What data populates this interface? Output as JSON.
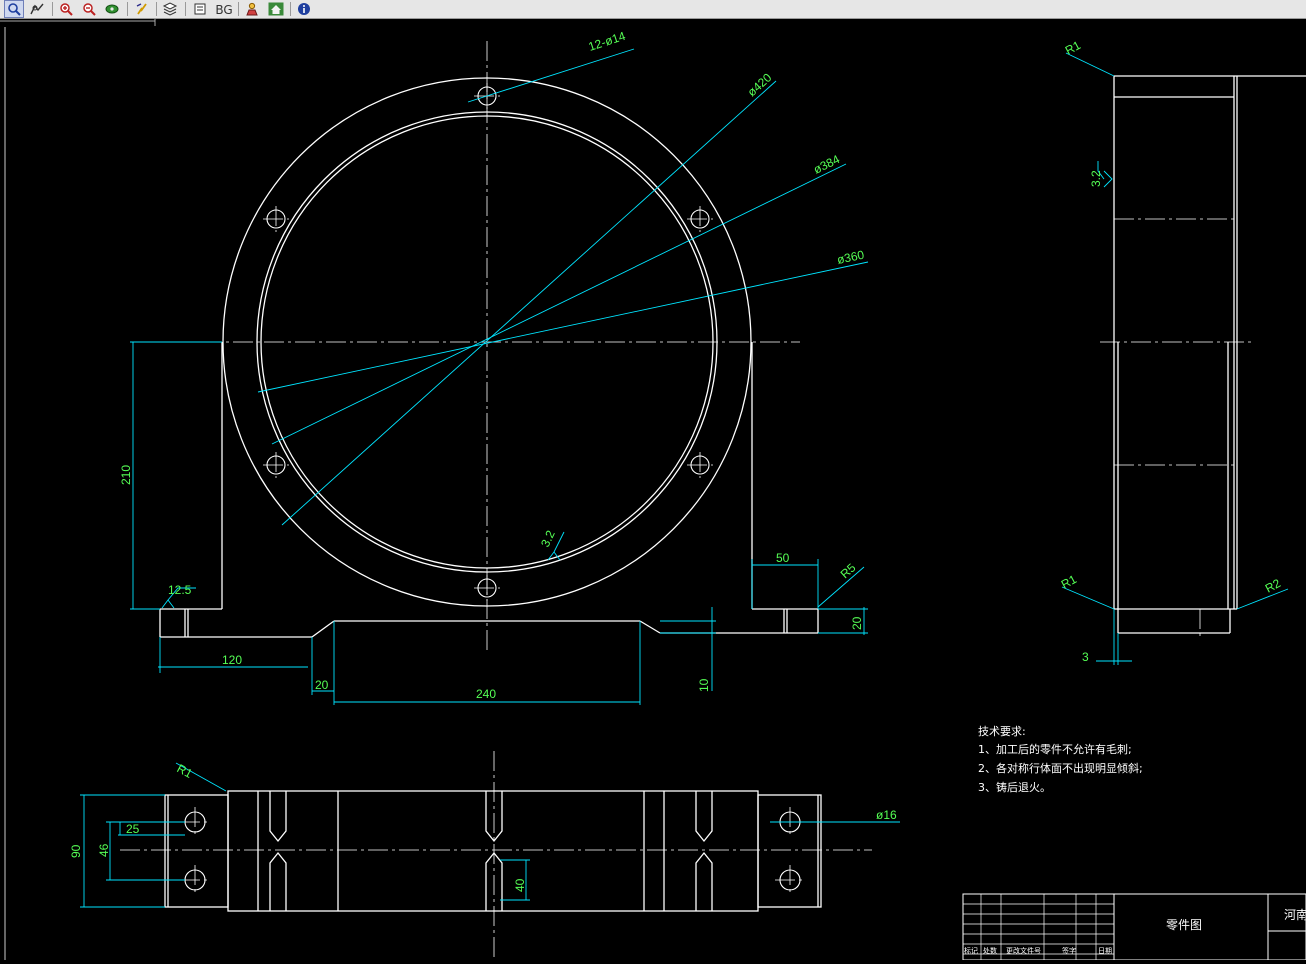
{
  "toolbar": {
    "bg_label": "BG",
    "buttons": [
      "zoom-window",
      "zoom-realtime",
      "zoom-in",
      "zoom-out",
      "pan",
      "regen",
      "layers",
      "properties",
      "bg",
      "user",
      "home",
      "info"
    ]
  },
  "colors": {
    "background": "#000000",
    "geometry": "#ffffff",
    "dimension_text": "#55ff55",
    "dimension_line": "#00e5ff"
  },
  "front_view": {
    "callouts": {
      "holes": "12-ø14",
      "dia_outer": "ø420",
      "dia_mid": "ø384",
      "dia_inner": "ø360"
    },
    "dims": {
      "height": "210",
      "rough_left": "12.5",
      "rough_bore": "3.2",
      "left_base": "120",
      "chamfer": "20",
      "base_center": "240",
      "base_step": "10",
      "foot_width": "50",
      "foot_radius": "R5",
      "base_height": "20"
    }
  },
  "side_view": {
    "dims": {
      "r_top": "R1",
      "rough": "3.2",
      "r_bottom_left": "R1",
      "r_bottom_right": "R2",
      "offset": "3"
    }
  },
  "top_view": {
    "dims": {
      "radius": "R1",
      "width": "90",
      "spacing": "46",
      "offset": "25",
      "slot": "40",
      "hole": "ø16"
    }
  },
  "tech_notes": {
    "title": "技术要求:",
    "items": [
      "1、加工后的零件不允许有毛刺;",
      "2、各对称行体面不出现明显倾斜;",
      "3、铸后退火。"
    ]
  },
  "title_block": {
    "drawing_name": "零件图",
    "company_partial": "河南",
    "headers": [
      "标记",
      "处数",
      "更改文件号",
      "签字",
      "日期"
    ]
  }
}
